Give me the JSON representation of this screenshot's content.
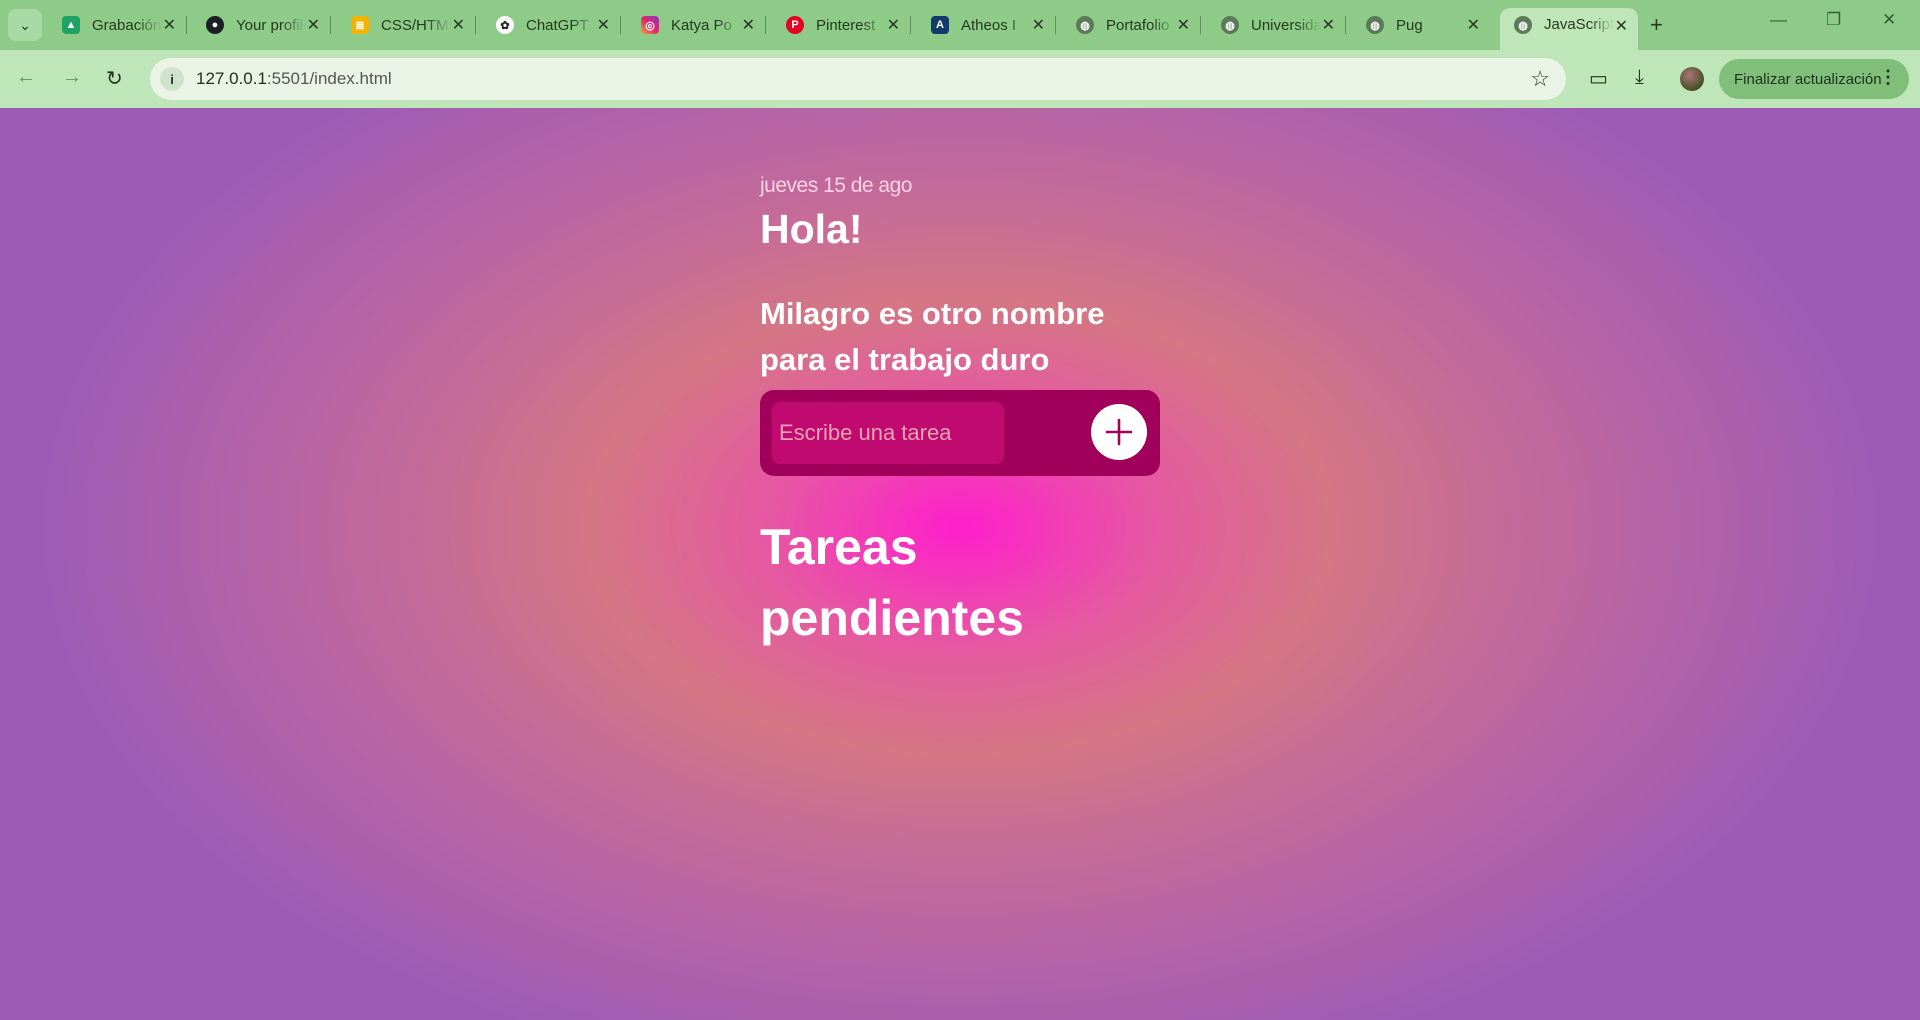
{
  "browser": {
    "tabs": [
      {
        "title": "Grabación",
        "favicon": "google-drive-icon"
      },
      {
        "title": "Your profile",
        "favicon": "github-icon"
      },
      {
        "title": "CSS/HTML",
        "favicon": "stackoverflow-icon"
      },
      {
        "title": "ChatGPT",
        "favicon": "chatgpt-icon"
      },
      {
        "title": "Katya Po",
        "favicon": "instagram-icon"
      },
      {
        "title": "Pinterest",
        "favicon": "pinterest-icon"
      },
      {
        "title": "Atheos I",
        "favicon": "atheos-icon"
      },
      {
        "title": "Portafolio",
        "favicon": "globe-icon"
      },
      {
        "title": "Universidad",
        "favicon": "globe-icon"
      },
      {
        "title": "Pug",
        "favicon": "globe-icon"
      },
      {
        "title": "JavaScript",
        "favicon": "globe-icon",
        "active": true
      }
    ],
    "url_host": "127.0.0.1",
    "url_path": ":5501/index.html",
    "update_button": "Finalizar actualización"
  },
  "app": {
    "date": "jueves 15 de ago",
    "greeting": "Hola!",
    "quote": "Milagro es otro nombre para el trabajo duro",
    "task_input_placeholder": "Escribe una tarea",
    "pending_title": "Tareas pendientes"
  },
  "colors": {
    "browser_frame": "#8ecb89",
    "task_box": "#a1005a",
    "task_input": "#c10a70",
    "add_button_icon": "#a1005a",
    "background_center": "#ff1fcc",
    "background_edge": "#9e5bb6"
  }
}
